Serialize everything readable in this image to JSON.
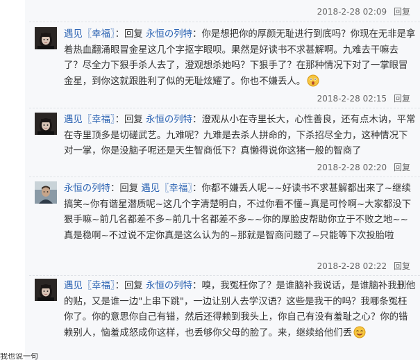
{
  "top_meta": {
    "time": "2018-2-28 02:09",
    "reply_label": "回复"
  },
  "replies": [
    {
      "user": "遇见〖幸福〗",
      "action": "回复",
      "target": "永恒の列特",
      "text": "你是想把你的厚颜无耻进行到底吗？你现在无非是拿着热血翻涌眼冒金星这几个字抠字眼呗。果然是好读书不求甚解啊。九难去干嘛去了？尽全力下狠手杀人去了，澄观想杀她吗？下狠手了？在那种情况下对了一掌眼冒金星，到你这就跟胜利了似的无耻炫耀了。你也不嫌丢人。",
      "emoji": "shocked-face-emoji",
      "time": "2018-2-28 02:15",
      "reply_label": "回复"
    },
    {
      "user": "遇见〖幸福〗",
      "action": "回复",
      "target": "永恒の列特",
      "text": "澄观从小在寺里长大，心性善良，还有点木讷，平常在寺里顶多是切磋武艺。九难呢？九难是去杀人拼命的，下杀招尽全力，这种情况下对一掌，你是没脑子呢还是天生智商低下？真懒得说你这猪一般的智商了",
      "time": "2018-2-28 02:20",
      "reply_label": "回复"
    },
    {
      "user": "永恒の列特",
      "action": "回复",
      "target": "遇见〖幸福〗",
      "text": "你都不嫌丢人呢~~好读书不求甚解都出来了~继续搞笑~你有谐星潜质呢~这几个字清楚明白，不过你看不懂~真是可怜啊~大家都没下狠手嘛~前几名都差不多~前几十名都差不多~~你的厚脸皮帮助你立于不败之地~~真是稳啊~不过说不定你真是这么认为的~那就是智商问题了~只能等下次投胎啦",
      "time": "2018-2-28 02:22",
      "reply_label": "回复"
    },
    {
      "user": "遇见〖幸福〗",
      "action": "回复",
      "target": "永恒の列特",
      "text": "嗅，我冤枉你了？是谁脑补我说话，是谁脑补我删他的贴，又是谁一边\"上串下跳\"，一边让别人去学汉语？这些是我干的吗？我哪条冤枉你了。你的意思你自己有错，然后还得赖到我头上，你自己有没有羞耻之心？你的错赖别人，恼羞成怒成你这样，也丢够你父母的脸了。来，继续给他们丢",
      "emoji": "smiling-face-emoji"
    }
  ],
  "footer_text": "我也说一句"
}
